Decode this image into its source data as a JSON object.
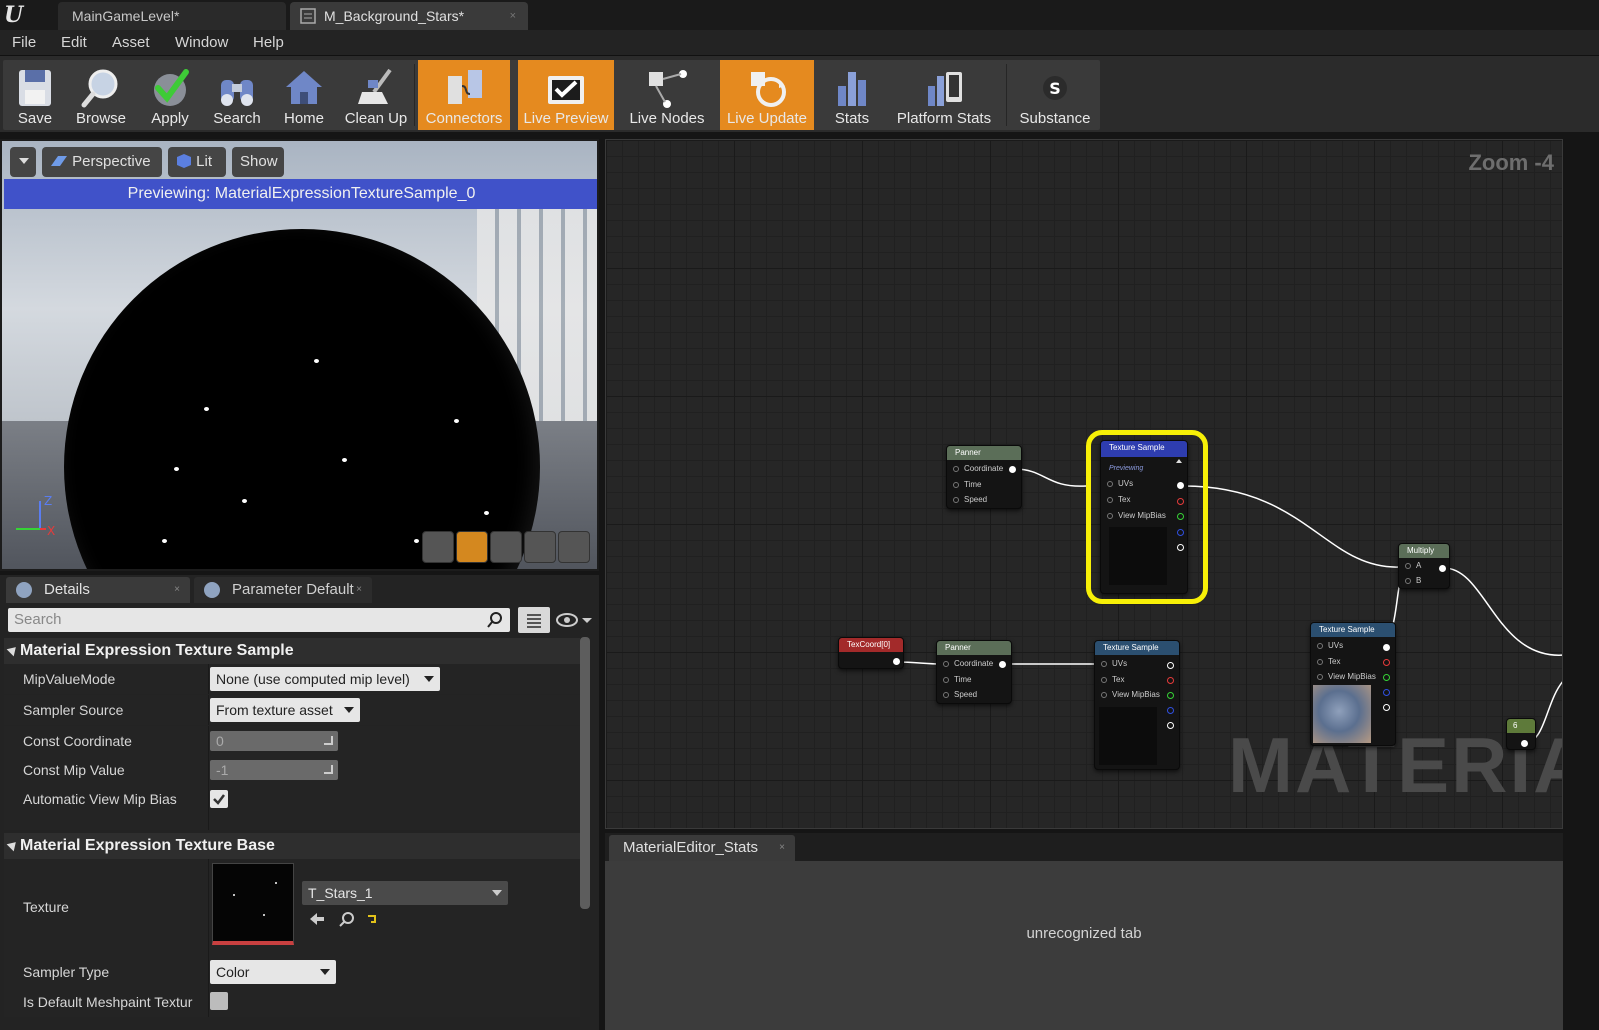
{
  "tabs": [
    {
      "label": "MainGameLevel*"
    },
    {
      "label": "M_Background_Stars*",
      "close": "×"
    }
  ],
  "menu": [
    "File",
    "Edit",
    "Asset",
    "Window",
    "Help"
  ],
  "toolbar": {
    "buttons": [
      {
        "label": "Save",
        "icon": "save-icon",
        "active": false
      },
      {
        "label": "Browse",
        "icon": "browse-icon",
        "active": false
      },
      {
        "label": "Apply",
        "icon": "apply-icon",
        "active": false
      },
      {
        "label": "Search",
        "icon": "search-icon",
        "active": false
      },
      {
        "label": "Home",
        "icon": "home-icon",
        "active": false
      },
      {
        "label": "Clean Up",
        "icon": "clean-up-icon",
        "active": false
      },
      {
        "label": "Connectors",
        "icon": "connectors-icon",
        "active": true
      },
      {
        "label": "Live Preview",
        "icon": "live-preview-icon",
        "active": true
      },
      {
        "label": "Live Nodes",
        "icon": "live-nodes-icon",
        "active": false
      },
      {
        "label": "Live Update",
        "icon": "live-update-icon",
        "active": true
      },
      {
        "label": "Stats",
        "icon": "stats-icon",
        "active": false
      },
      {
        "label": "Platform Stats",
        "icon": "platform-stats-icon",
        "active": false
      },
      {
        "label": "Substance",
        "icon": "substance-icon",
        "active": false
      }
    ],
    "active_color": "#e58a1f"
  },
  "viewport": {
    "perspective": "Perspective",
    "lit": "Lit",
    "show": "Show",
    "banner": "Previewing: MaterialExpressionTextureSample_0",
    "axis_z": "Z",
    "axis_x": "X",
    "banner_color": "#4052c9"
  },
  "details": {
    "tab_details": "Details",
    "tab_params": "Parameter Default",
    "tab_close": "×",
    "search_placeholder": "Search",
    "section1": "Material Expression Texture Sample",
    "props1": [
      {
        "name": "MipValueMode",
        "value": "None (use computed mip level)"
      },
      {
        "name": "Sampler Source",
        "value": "From texture asset"
      },
      {
        "name": "Const Coordinate",
        "value": "0"
      },
      {
        "name": "Const Mip Value",
        "value": "-1"
      },
      {
        "name": "Automatic View Mip Bias",
        "checked": true
      }
    ],
    "section2": "Material Expression Texture Base",
    "props2": [
      {
        "name": "Texture",
        "value": "T_Stars_1"
      },
      {
        "name": "Sampler Type",
        "value": "Color"
      },
      {
        "name": "Is Default Meshpaint Textur",
        "checked": false
      }
    ]
  },
  "graph": {
    "zoom": "Zoom -4",
    "watermark": "MATERIAL",
    "nodes": {
      "panner1": {
        "title": "Panner",
        "pins": [
          "Coordinate",
          "Time",
          "Speed"
        ]
      },
      "tex_selected": {
        "title": "Texture Sample",
        "sub": "Previewing",
        "pins": [
          "UVs",
          "Tex",
          "View MipBias"
        ]
      },
      "multiply": {
        "title": "Multiply",
        "pins": [
          "A",
          "B"
        ]
      },
      "texcoord": {
        "title": "TexCoord[0]"
      },
      "panner2": {
        "title": "Panner",
        "pins": [
          "Coordinate",
          "Time",
          "Speed"
        ]
      },
      "tex2": {
        "title": "Texture Sample",
        "pins": [
          "UVs",
          "Tex",
          "View MipBias"
        ]
      },
      "tex3": {
        "title": "Texture Sample",
        "pins": [
          "UVs",
          "Tex",
          "View MipBias"
        ]
      },
      "const": {
        "title": "6"
      }
    },
    "selection_color": "#f7f007"
  },
  "stats": {
    "tab": "MaterialEditor_Stats",
    "close": "×",
    "body": "unrecognized tab"
  }
}
